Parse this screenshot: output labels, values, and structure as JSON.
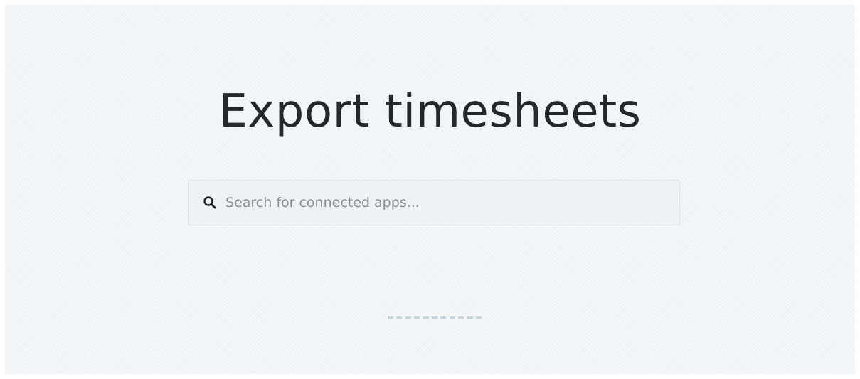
{
  "page": {
    "title": "Export timesheets"
  },
  "search": {
    "placeholder": "Search for connected apps...",
    "value": "",
    "icon": "search-icon"
  },
  "loader": {
    "icon": "loading-indicator",
    "segments": 11
  },
  "colors": {
    "background": "#eff3f6",
    "title": "#25282b",
    "input_background": "#eef2f5",
    "placeholder": "#8a8f94",
    "loader": "#c9d5dc"
  }
}
